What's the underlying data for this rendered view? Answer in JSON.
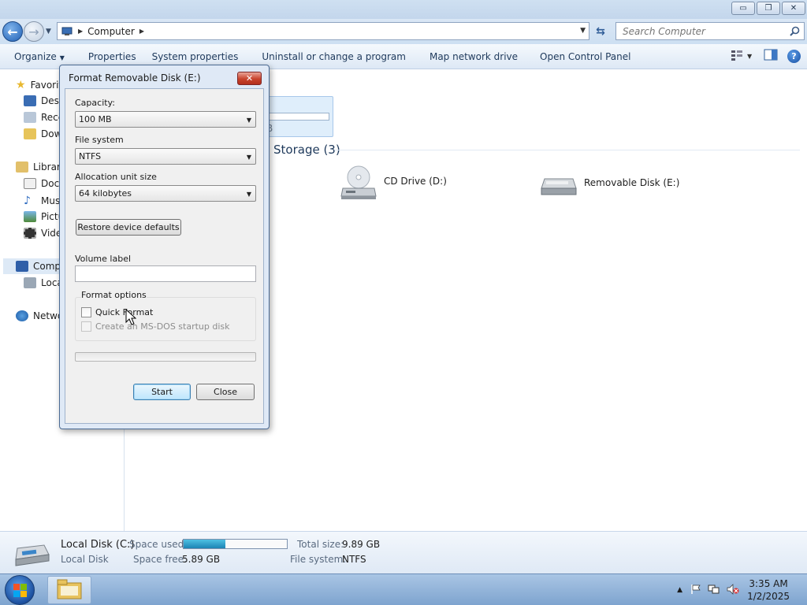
{
  "window": {
    "minimize_glyph": "▭",
    "maximize_glyph": "❐",
    "close_glyph": "✕"
  },
  "address": {
    "breadcrumb": "Computer",
    "search_placeholder": "Search Computer"
  },
  "toolbar": {
    "organize": "Organize",
    "properties": "Properties",
    "system_properties": "System properties",
    "uninstall": "Uninstall or change a program",
    "map_drive": "Map network drive",
    "control_panel": "Open Control Panel"
  },
  "nav": {
    "favorites": "Favorit",
    "desktop": "Desk",
    "recent": "Rece",
    "downloads": "Dow",
    "libraries": "Librari",
    "documents": "Docu",
    "music": "Mus",
    "pictures": "Pictu",
    "videos": "Vide",
    "computer": "Comp",
    "local_disk": "Loca",
    "network": "Netwo"
  },
  "content": {
    "group_title": "Storage (3)",
    "hidden_fragment": "B",
    "drives": [
      {
        "label": "CD Drive (D:)",
        "icon": "cd-drive-icon"
      },
      {
        "label": "Removable Disk (E:)",
        "icon": "removable-disk-icon"
      }
    ]
  },
  "details": {
    "name": "Local Disk (C:)",
    "type": "Local Disk",
    "space_used_label": "Space used:",
    "space_free_label": "Space free:",
    "space_free": "5.89 GB",
    "total_size_label": "Total size:",
    "total_size": "9.89 GB",
    "file_system_label": "File system:",
    "file_system": "NTFS",
    "used_fraction": 0.404
  },
  "dialog": {
    "title": "Format Removable Disk (E:)",
    "capacity_label": "Capacity:",
    "capacity_value": "100 MB",
    "filesystem_label": "File system",
    "filesystem_value": "NTFS",
    "allocation_label": "Allocation unit size",
    "allocation_value": "64 kilobytes",
    "restore_button": "Restore device defaults",
    "volume_label": "Volume label",
    "volume_value": "",
    "format_options_label": "Format options",
    "quick_format": "Quick Format",
    "msdos_disk": "Create an MS-DOS startup disk",
    "start_button": "Start",
    "close_button": "Close",
    "progress": 0
  },
  "taskbar": {
    "time": "3:35 AM",
    "date": "1/2/2025"
  },
  "colors": {
    "accent": "#1e395b",
    "usage_fill": "#1c84b4",
    "close_red": "#c8432c"
  }
}
